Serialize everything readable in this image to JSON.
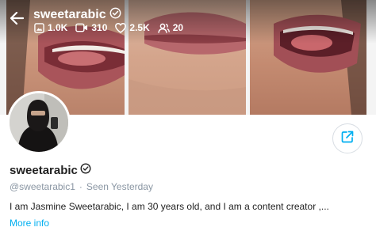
{
  "header": {
    "username": "sweetarabic",
    "stats": [
      {
        "icon": "image-icon",
        "value": "1.0K"
      },
      {
        "icon": "video-icon",
        "value": "310"
      },
      {
        "icon": "heart-icon",
        "value": "2.5K"
      },
      {
        "icon": "fans-icon",
        "value": "20"
      }
    ]
  },
  "profile": {
    "display_name": "sweetarabic",
    "handle": "@sweetarabic1",
    "separator": "·",
    "last_seen": "Seen Yesterday",
    "bio": "I am Jasmine Sweetarabic, I am 30 years old, and I am a content creator ,...",
    "more_label": "More info"
  },
  "colors": {
    "accent": "#00aff0",
    "muted": "#8a96a3",
    "text": "#222222"
  }
}
